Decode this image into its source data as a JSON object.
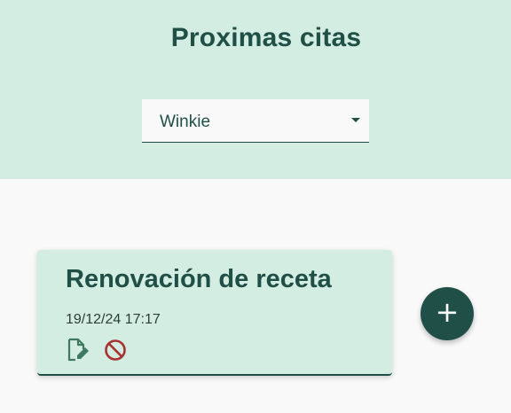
{
  "header": {
    "title": "Proximas citas",
    "pet_select": {
      "selected": "Winkie"
    }
  },
  "appointments": [
    {
      "title": "Renovación de receta",
      "datetime": "19/12/24 17:17",
      "edit_icon": "edit-document-icon",
      "cancel_icon": "block-icon"
    }
  ],
  "add_button": {
    "label": "+",
    "icon": "plus-icon"
  },
  "colors": {
    "primary": "#1f4f47",
    "header_bg": "#d4ede2",
    "page_bg": "#f9f9f9",
    "edit_icon": "#3f7a60",
    "cancel_icon": "#a83232"
  }
}
